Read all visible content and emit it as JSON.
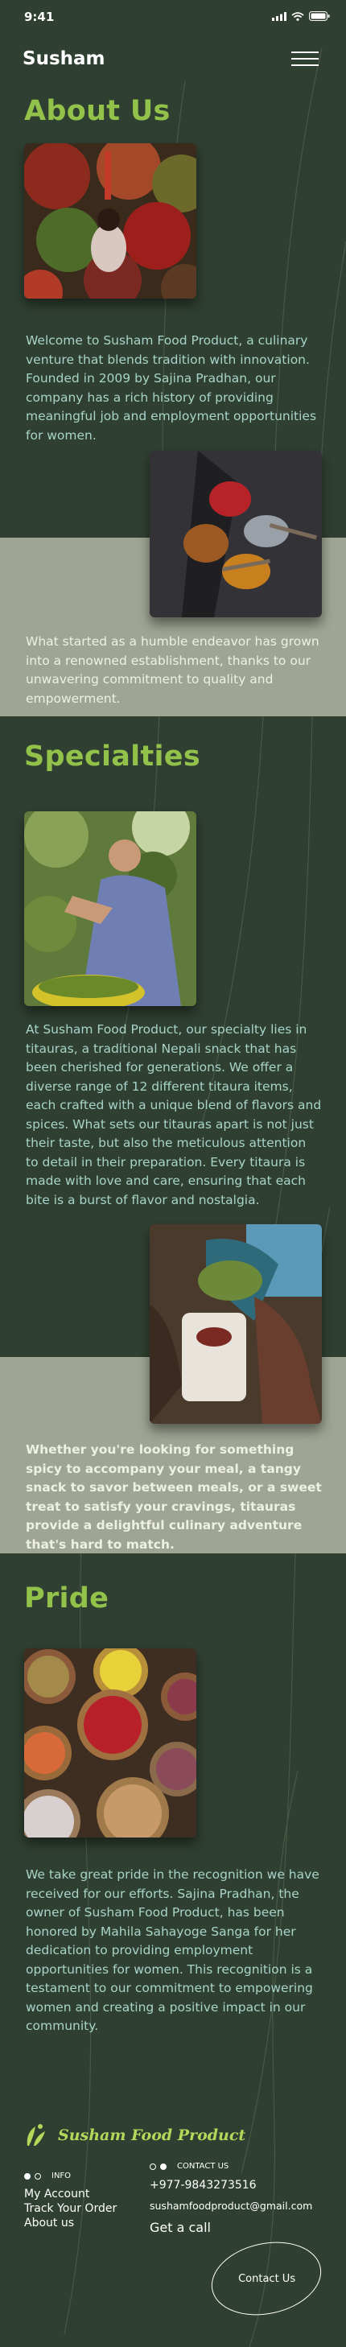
{
  "status_bar": {
    "time": "9:41"
  },
  "header": {
    "brand": "Susham",
    "menu_icon": "hamburger-menu-icon"
  },
  "about": {
    "title": "About Us",
    "intro": "Welcome to Susham Food Product, a culinary venture that blends tradition with innovation. Founded in 2009 by Sajina Pradhan, our company has a rich history of providing meaningful job and employment opportunities for women.",
    "growth": "What started as a humble endeavor has grown into a renowned establishment, thanks to our unwavering commitment to quality and empowerment."
  },
  "specialties": {
    "title": "Specialties",
    "body": "At Susham Food Product, our specialty lies in titauras, a traditional Nepali snack that has been cherished for generations. We offer a diverse range of 12 different titaura items, each crafted with a unique blend of flavors and spices. What sets our titauras apart is not just their taste, but also the meticulous attention to detail in their preparation. Every titaura is made with love and care, ensuring that each bite is a burst of flavor and nostalgia.",
    "highlight": "Whether you're looking for something spicy to accompany your meal, a tangy snack to savor between meals, or a sweet treat to satisfy your cravings, titauras provide a delightful culinary adventure that's hard to match."
  },
  "pride": {
    "title": "Pride",
    "body": "We take great pride in the recognition we have received for our efforts. Sajina Pradhan, the owner of Susham Food Product, has been honored by Mahila Sahayoge Sanga for her dedication to providing employment opportunities for women. This recognition is a testament to our commitment to empowering women and creating a positive impact in our community."
  },
  "footer": {
    "logo_text": "Susham Food Product",
    "info_heading": "INFO",
    "info_links": [
      "My Account",
      "Track Your Order",
      "About us"
    ],
    "contact_heading": "CONTACT US",
    "phone": "+977-9843273516",
    "email": "sushamfoodproduct@gmail.com",
    "get_a_call": "Get a call",
    "contact_button": "Contact Us"
  },
  "colors": {
    "background": "#2f3f31",
    "accent_green": "#93c24a",
    "text_mint": "#a8d4c9",
    "band": "#9ea593"
  }
}
